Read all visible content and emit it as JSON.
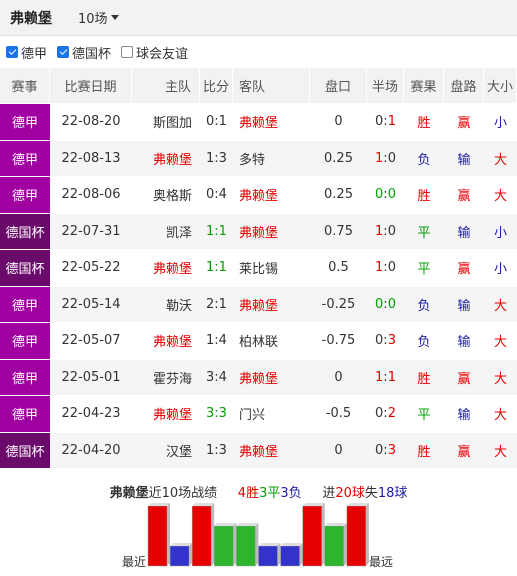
{
  "header": {
    "team": "弗赖堡",
    "match_count": "10场"
  },
  "filters": [
    {
      "label": "德甲",
      "checked": true
    },
    {
      "label": "德国杯",
      "checked": true
    },
    {
      "label": "球会友谊",
      "checked": false
    }
  ],
  "columns": [
    "赛事",
    "比赛日期",
    "主队",
    "比分",
    "客队",
    "盘口",
    "半场",
    "赛果",
    "盘路",
    "大小"
  ],
  "rows": [
    {
      "league": "德甲",
      "date": "22-08-20",
      "home": "斯图加",
      "score": "0:1",
      "away": "弗赖堡",
      "handicap": "0",
      "half": "0:1",
      "result": "胜",
      "pan": "赢",
      "ou": "小"
    },
    {
      "league": "德甲",
      "date": "22-08-13",
      "home": "弗赖堡",
      "score": "1:3",
      "away": "多特",
      "handicap": "0.25",
      "half": "1:0",
      "result": "负",
      "pan": "输",
      "ou": "大"
    },
    {
      "league": "德甲",
      "date": "22-08-06",
      "home": "奥格斯",
      "score": "0:4",
      "away": "弗赖堡",
      "handicap": "0.25",
      "half": "0:0",
      "result": "胜",
      "pan": "赢",
      "ou": "大"
    },
    {
      "league": "德国杯",
      "date": "22-07-31",
      "home": "凯泽",
      "score": "1:1",
      "away": "弗赖堡",
      "handicap": "0.75",
      "half": "1:0",
      "result": "平",
      "pan": "输",
      "ou": "小"
    },
    {
      "league": "德国杯",
      "date": "22-05-22",
      "home": "弗赖堡",
      "score": "1:1",
      "away": "莱比锡",
      "handicap": "0.5",
      "half": "1:0",
      "result": "平",
      "pan": "赢",
      "ou": "小"
    },
    {
      "league": "德甲",
      "date": "22-05-14",
      "home": "勒沃",
      "score": "2:1",
      "away": "弗赖堡",
      "handicap": "-0.25",
      "half": "0:0",
      "result": "负",
      "pan": "输",
      "ou": "大"
    },
    {
      "league": "德甲",
      "date": "22-05-07",
      "home": "弗赖堡",
      "score": "1:4",
      "away": "柏林联",
      "handicap": "-0.75",
      "half": "0:3",
      "result": "负",
      "pan": "输",
      "ou": "大"
    },
    {
      "league": "德甲",
      "date": "22-05-01",
      "home": "霍芬海",
      "score": "3:4",
      "away": "弗赖堡",
      "handicap": "0",
      "half": "1:1",
      "result": "胜",
      "pan": "赢",
      "ou": "大"
    },
    {
      "league": "德甲",
      "date": "22-04-23",
      "home": "弗赖堡",
      "score": "3:3",
      "away": "门兴",
      "handicap": "-0.5",
      "half": "0:2",
      "result": "平",
      "pan": "输",
      "ou": "大"
    },
    {
      "league": "德国杯",
      "date": "22-04-20",
      "home": "汉堡",
      "score": "1:3",
      "away": "弗赖堡",
      "handicap": "0",
      "half": "0:3",
      "result": "胜",
      "pan": "赢",
      "ou": "大"
    }
  ],
  "summary": {
    "team": "弗赖堡",
    "text1": "近10场战绩",
    "wins": "4胜",
    "draws": "3平",
    "losses": "3负",
    "goals_pre": "进",
    "goals_for": "20球",
    "goals_mid": "失",
    "goals_against": "18球"
  },
  "bars": {
    "left_label": "最近",
    "right_label": "最远",
    "results": [
      "胜",
      "负",
      "胜",
      "平",
      "平",
      "负",
      "负",
      "胜",
      "平",
      "胜"
    ]
  },
  "colors": {
    "league_德甲": "#a000a0",
    "league_德国杯": "#6a0a6a",
    "win": "#e60000",
    "draw": "#2db52d",
    "loss": "#3333cc",
    "team_red": "#e60000"
  }
}
